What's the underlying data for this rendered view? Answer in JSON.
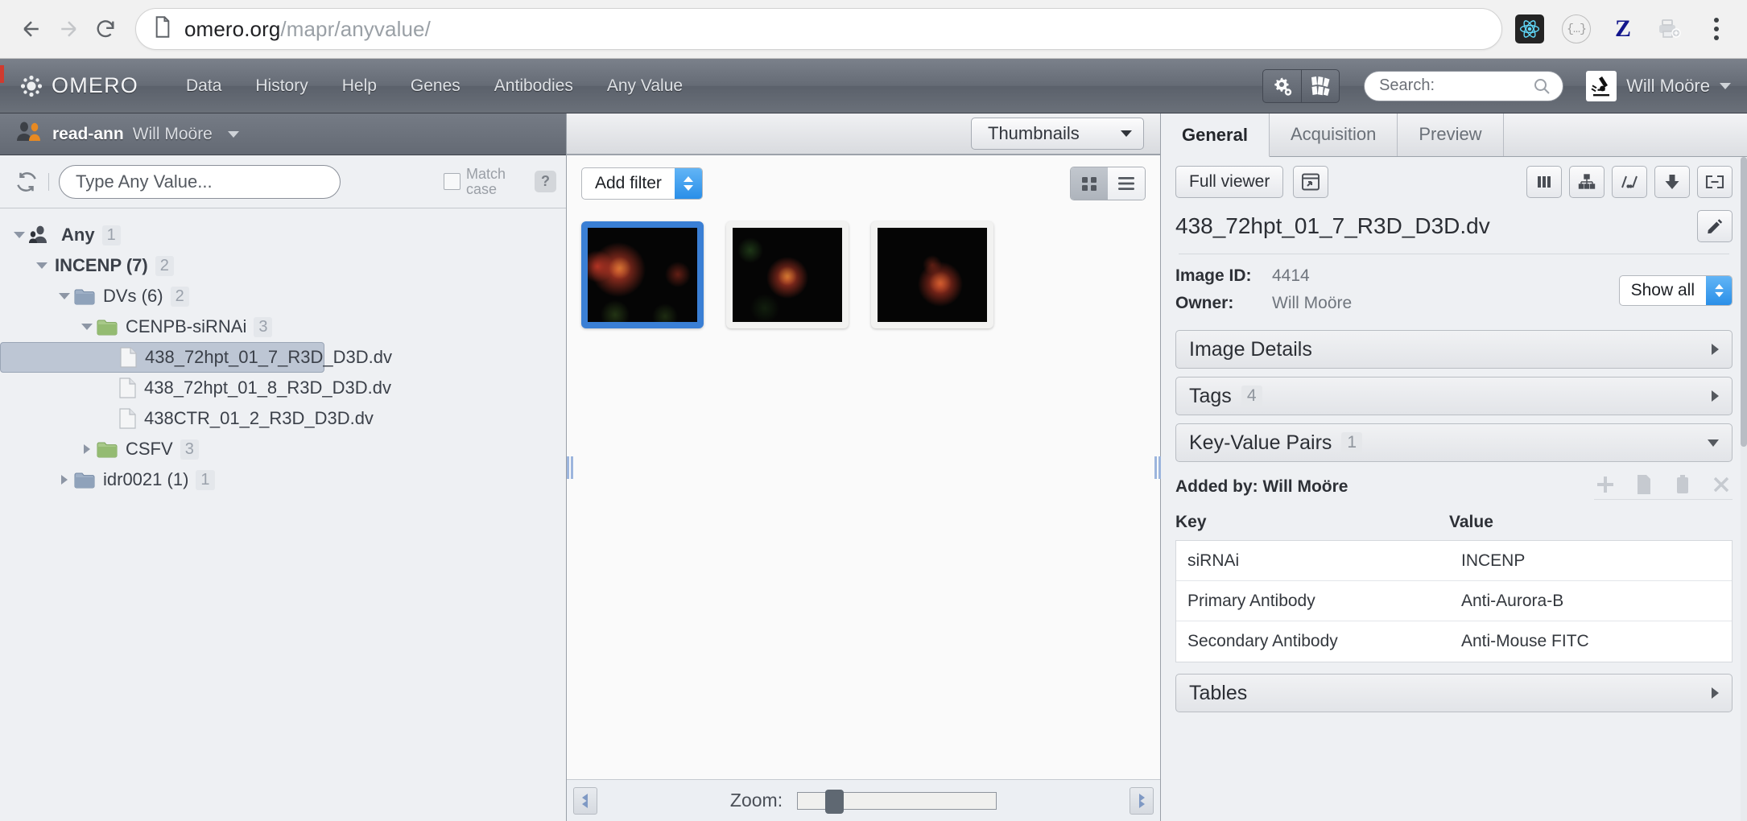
{
  "browser": {
    "url_bold": "omero.org",
    "url_rest": "/mapr/anyvalue/",
    "back_icon": "back-arrow-icon",
    "forward_icon": "forward-arrow-icon",
    "reload_icon": "reload-icon",
    "page_icon": "document-icon",
    "extensions": [
      {
        "name": "react-devtools-icon",
        "label": ""
      },
      {
        "name": "json-viewer-icon",
        "label": "{…}"
      },
      {
        "name": "zotero-connector-icon",
        "label": "Z"
      },
      {
        "name": "print-icon",
        "label": ""
      }
    ],
    "menu_icon": "kebab-menu-icon"
  },
  "omero_header": {
    "brand": "OMERO",
    "nav": [
      {
        "label": "Data"
      },
      {
        "label": "History"
      },
      {
        "label": "Help"
      },
      {
        "label": "Genes"
      },
      {
        "label": "Antibodies"
      },
      {
        "label": "Any Value"
      }
    ],
    "buttons": [
      {
        "name": "admin-gear-button"
      },
      {
        "name": "plates-button"
      }
    ],
    "search": {
      "placeholder": "Search:",
      "value": ""
    },
    "user": "Will Moöre"
  },
  "left_panel": {
    "user_bar": {
      "group": "read-ann",
      "user": "Will Moöre"
    },
    "filter": {
      "refresh_icon": "refresh-icon",
      "input_placeholder": "Type Any Value...",
      "input_value": "",
      "match_case_label_1": "Match",
      "match_case_label_2": "case",
      "match_case_checked": false,
      "help_label": "?"
    },
    "tree": [
      {
        "label": "Any",
        "count": "1",
        "icon": "people-icon",
        "twist": "open",
        "indent": 0,
        "selected": false
      },
      {
        "label": "INCENP (7)",
        "count": "2",
        "icon": "none",
        "twist": "open",
        "indent": 1,
        "selected": false
      },
      {
        "label": "DVs (6)",
        "count": "2",
        "icon": "folder-blue",
        "twist": "open",
        "indent": 2,
        "selected": false
      },
      {
        "label": "CENPB-siRNAi",
        "count": "3",
        "icon": "folder-green",
        "twist": "open",
        "indent": 3,
        "selected": false
      },
      {
        "label": "438_72hpt_01_7_R3D_D3D.dv",
        "count": "",
        "icon": "document-icon",
        "twist": "none",
        "indent": 4,
        "selected": true
      },
      {
        "label": "438_72hpt_01_8_R3D_D3D.dv",
        "count": "",
        "icon": "document-icon",
        "twist": "none",
        "indent": 4,
        "selected": false
      },
      {
        "label": "438CTR_01_2_R3D_D3D.dv",
        "count": "",
        "icon": "document-icon",
        "twist": "none",
        "indent": 4,
        "selected": false
      },
      {
        "label": "CSFV",
        "count": "3",
        "icon": "folder-green",
        "twist": "closed",
        "indent": 3,
        "selected": false
      },
      {
        "label": "idr0021 (1)",
        "count": "1",
        "icon": "folder-blue",
        "twist": "closed",
        "indent": 2,
        "selected": false
      }
    ]
  },
  "center_panel": {
    "view_select": "Thumbnails",
    "add_filter": "Add filter",
    "view_modes": [
      {
        "name": "grid-view-button",
        "active": true
      },
      {
        "name": "list-view-button",
        "active": false
      }
    ],
    "thumbnails": [
      {
        "name": "thumbnail-438_72hpt_01_7",
        "selected": true
      },
      {
        "name": "thumbnail-438_72hpt_01_8",
        "selected": false
      },
      {
        "name": "thumbnail-438CTR_01_2",
        "selected": false
      }
    ],
    "zoom_label": "Zoom:",
    "zoom_value": 14
  },
  "right_panel": {
    "tabs": [
      {
        "label": "General",
        "active": true
      },
      {
        "label": "Acquisition",
        "active": false
      },
      {
        "label": "Preview",
        "active": false
      }
    ],
    "toolbar": {
      "full_viewer": "Full viewer",
      "open_window_icon": "open-in-window-icon",
      "icons": [
        {
          "name": "split-channel-icon"
        },
        {
          "name": "hierarchy-icon"
        },
        {
          "name": "plot-icon"
        },
        {
          "name": "download-icon"
        },
        {
          "name": "link-icon"
        }
      ]
    },
    "image_title": "438_72hpt_01_7_R3D_D3D.dv",
    "edit_icon": "pencil-edit-icon",
    "meta": [
      {
        "key": "Image ID:",
        "value": "4414"
      },
      {
        "key": "Owner:",
        "value": "Will Moöre"
      }
    ],
    "show_all": "Show all",
    "accordion": [
      {
        "title": "Image Details",
        "count": "",
        "expanded": false
      },
      {
        "title": "Tags",
        "count": "4",
        "expanded": false
      },
      {
        "title": "Key-Value Pairs",
        "count": "1",
        "expanded": true
      }
    ],
    "kv": {
      "added_by": "Added by: Will Moöre",
      "actions": [
        {
          "name": "add-kv-button"
        },
        {
          "name": "copy-kv-button"
        },
        {
          "name": "paste-kv-button"
        },
        {
          "name": "delete-kv-button"
        }
      ],
      "header": {
        "key": "Key",
        "value": "Value"
      },
      "rows": [
        {
          "key": "siRNAi",
          "value": "INCENP"
        },
        {
          "key": "Primary Antibody",
          "value": "Anti-Aurora-B"
        },
        {
          "key": "Secondary Antibody",
          "value": "Anti-Mouse FITC"
        }
      ]
    },
    "tables_section": {
      "title": "Tables",
      "expanded": false
    }
  },
  "colors": {
    "accent_blue": "#3a7fd5",
    "header_grey": "#656b75",
    "select_blue": "#2a8fe8",
    "panel_bg": "#eef0f3"
  }
}
